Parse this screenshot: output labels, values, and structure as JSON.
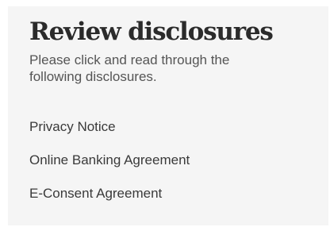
{
  "header": {
    "title": "Review disclosures",
    "subtitle": "Please click and read through the following disclosures."
  },
  "disclosures": [
    {
      "label": "Privacy Notice"
    },
    {
      "label": "Online Banking Agreement"
    },
    {
      "label": "E-Consent Agreement"
    }
  ],
  "colors": {
    "panel_background": "#f5f5f5",
    "title_text": "#2b2b2b",
    "body_text": "#555555"
  }
}
